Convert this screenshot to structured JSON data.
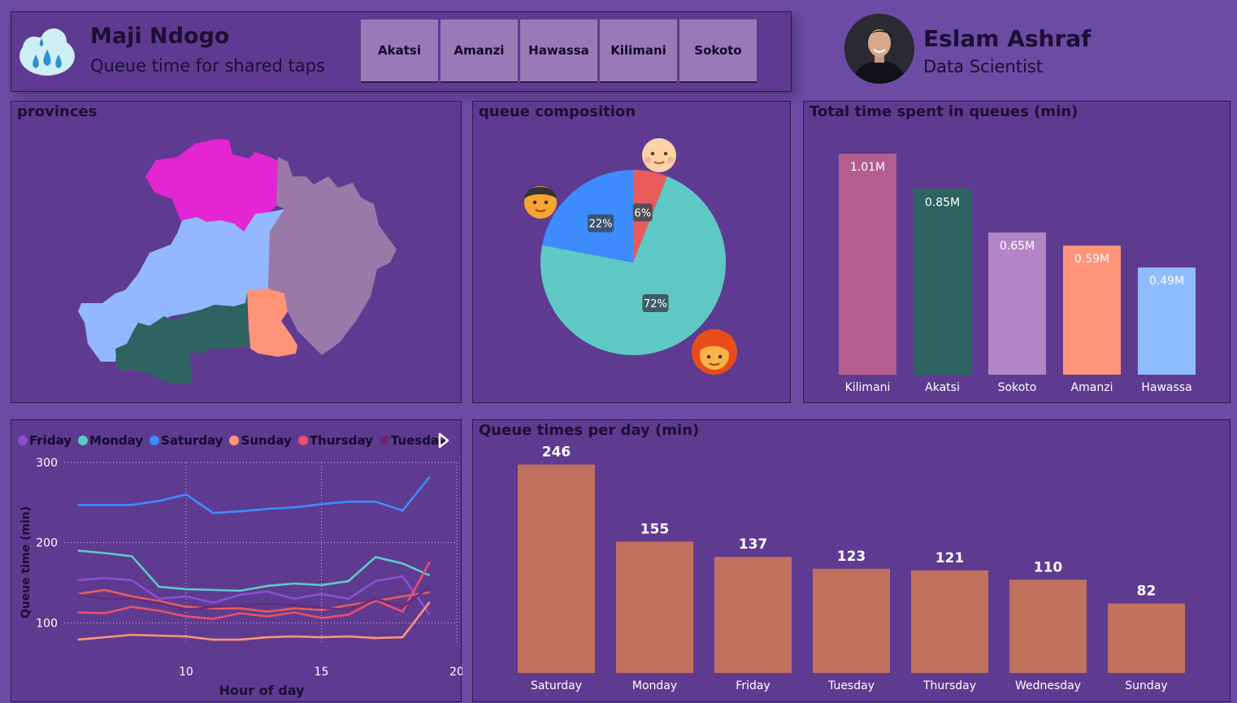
{
  "header": {
    "title": "Maji Ndogo",
    "subtitle": "Queue time for shared taps",
    "tabs": [
      "Akatsi",
      "Amanzi",
      "Hawassa",
      "Kilimani",
      "Sokoto"
    ]
  },
  "profile": {
    "name": "Eslam Ashraf",
    "role": "Data Scientist"
  },
  "map_panel": {
    "title": "provinces"
  },
  "composition_panel": {
    "title": "queue composition"
  },
  "total_panel": {
    "title": "Total time spent in queues (min)"
  },
  "hourly_panel": {
    "xlabel": "Hour of day",
    "ylabel": "Queue time (min)"
  },
  "daily_panel": {
    "title": "Queue times per day (min)"
  },
  "chart_data": [
    {
      "type": "pie",
      "categories": [
        "men",
        "women",
        "children"
      ],
      "values": [
        22,
        72,
        6
      ],
      "labels": [
        "22%",
        "72%",
        "6%"
      ],
      "colors": [
        "#3d8bfd",
        "#5ec9c4",
        "#e85c5c"
      ]
    },
    {
      "type": "bar",
      "categories": [
        "Kilimani",
        "Akatsi",
        "Sokoto",
        "Amanzi",
        "Hawassa"
      ],
      "values": [
        1.01,
        0.85,
        0.65,
        0.59,
        0.49
      ],
      "labels": [
        "1.01M",
        "0.85M",
        "0.65M",
        "0.59M",
        "0.49M"
      ],
      "colors": [
        "#b35e8f",
        "#2d6360",
        "#b385c5",
        "#ff9478",
        "#8fbcff"
      ],
      "ylim": [
        0,
        1.1
      ]
    },
    {
      "type": "line",
      "series": [
        {
          "name": "Friday",
          "color": "#8c4fd1",
          "x": [
            6,
            7,
            8,
            9,
            10,
            11,
            12,
            13,
            14,
            15,
            16,
            17,
            18,
            19
          ],
          "values": [
            153,
            156,
            153,
            130,
            133,
            125,
            135,
            139,
            130,
            136,
            130,
            152,
            158,
            110
          ]
        },
        {
          "name": "Monday",
          "color": "#5ec9c4",
          "x": [
            6,
            7,
            8,
            9,
            10,
            11,
            12,
            13,
            14,
            15,
            16,
            17,
            18,
            19
          ],
          "values": [
            190,
            187,
            183,
            145,
            142,
            141,
            140,
            146,
            149,
            147,
            152,
            182,
            174,
            159
          ]
        },
        {
          "name": "Saturday",
          "color": "#3d8bfd",
          "x": [
            6,
            7,
            8,
            9,
            10,
            11,
            12,
            13,
            14,
            15,
            16,
            17,
            18,
            19
          ],
          "values": [
            247,
            247,
            247,
            252,
            260,
            237,
            239,
            242,
            244,
            248,
            251,
            251,
            240,
            282
          ]
        },
        {
          "name": "Sunday",
          "color": "#ff9478",
          "x": [
            6,
            7,
            8,
            9,
            10,
            11,
            12,
            13,
            14,
            15,
            16,
            17,
            18,
            19
          ],
          "values": [
            79,
            82,
            85,
            84,
            83,
            79,
            79,
            82,
            83,
            82,
            83,
            81,
            82,
            126
          ]
        },
        {
          "name": "Thursday",
          "color": "#e8506b",
          "x": [
            6,
            7,
            8,
            9,
            10,
            11,
            12,
            13,
            14,
            15,
            16,
            17,
            18,
            19
          ],
          "values": [
            113,
            112,
            120,
            115,
            108,
            105,
            112,
            108,
            113,
            106,
            110,
            128,
            114,
            176
          ]
        },
        {
          "name": "Tuesday",
          "color": "#6a2a78",
          "x": [
            6,
            7,
            8,
            9,
            10,
            11,
            12,
            13,
            14,
            15,
            16,
            17,
            18,
            19
          ],
          "values": [
            135,
            130,
            130,
            125,
            116,
            120,
            121,
            124,
            122,
            119,
            116,
            130,
            120,
            145
          ]
        }
      ],
      "extra_series": [
        {
          "color": "#e85c5c",
          "x": [
            6,
            7,
            8,
            9,
            10,
            11,
            12,
            13,
            14,
            15,
            16,
            17,
            18,
            19
          ],
          "values": [
            136,
            141,
            133,
            127,
            120,
            118,
            118,
            114,
            118,
            116,
            122,
            127,
            133,
            138
          ]
        }
      ],
      "xlim": [
        5.5,
        20
      ],
      "ylim": [
        75,
        300
      ],
      "xticks": [
        10,
        15,
        20
      ],
      "yticks": [
        100,
        200,
        300
      ]
    },
    {
      "type": "bar",
      "categories": [
        "Saturday",
        "Monday",
        "Friday",
        "Tuesday",
        "Thursday",
        "Wednesday",
        "Sunday"
      ],
      "values": [
        246,
        155,
        137,
        123,
        121,
        110,
        82
      ],
      "color": "#c0705c",
      "ylim": [
        0,
        260
      ]
    }
  ]
}
